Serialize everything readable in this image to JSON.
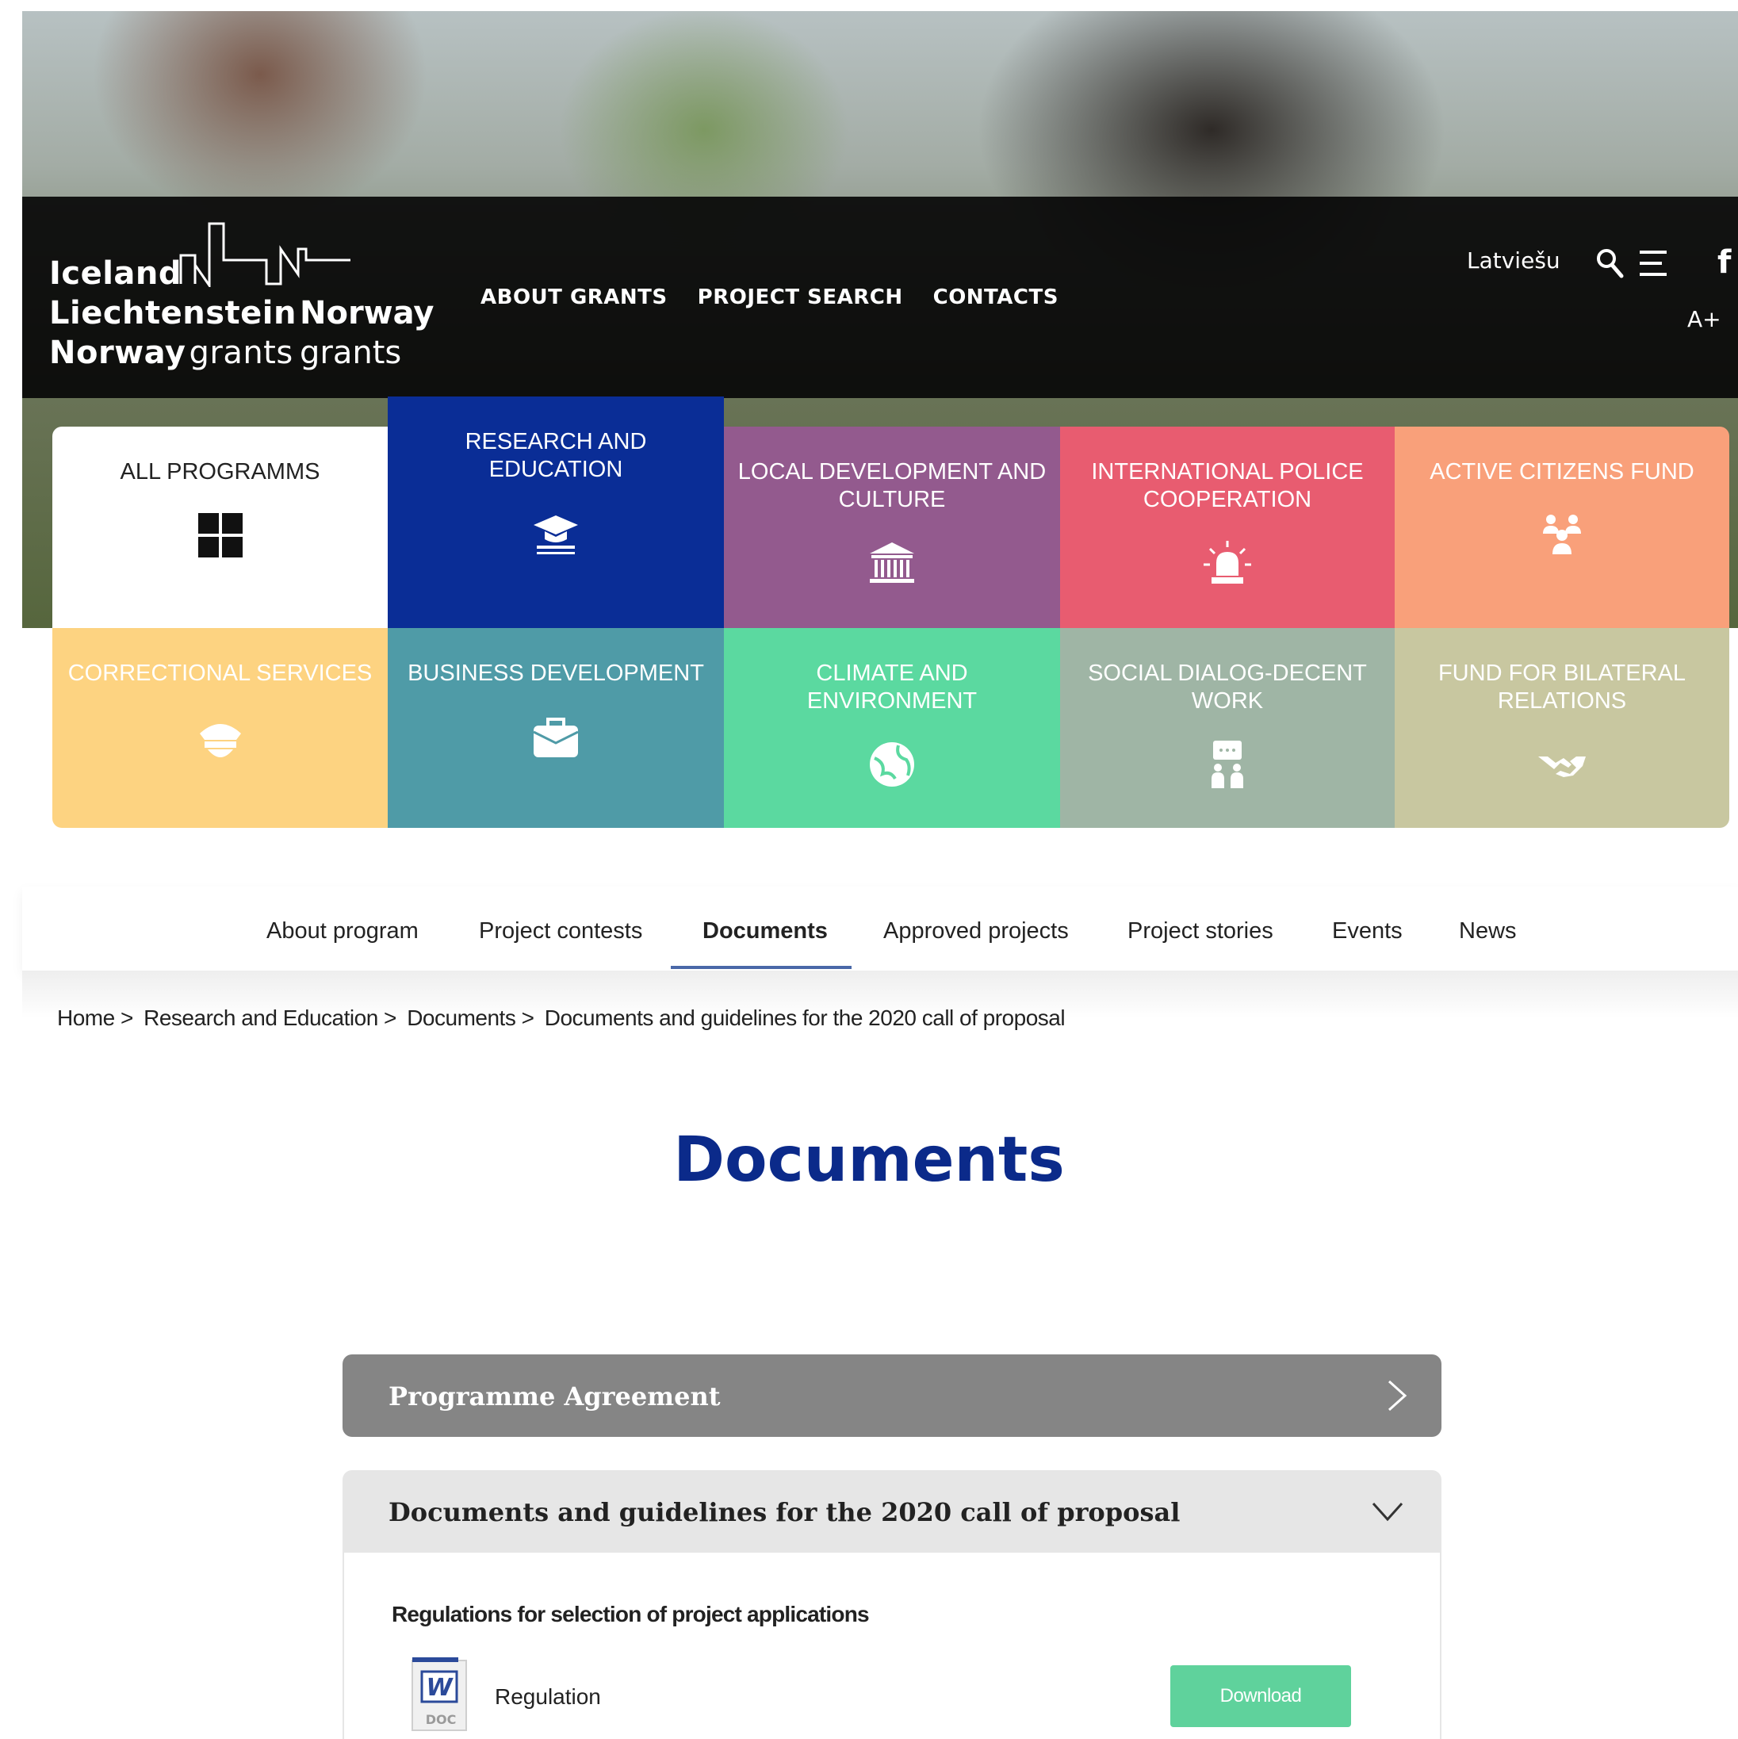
{
  "header": {
    "logo": {
      "line1": "Iceland",
      "line2": "Liechtenstein",
      "line3_bold": "Norway",
      "line3_thin": "grants",
      "right_bold": "Norway",
      "right_thin": "grants"
    },
    "nav": [
      "ABOUT GRANTS",
      "PROJECT SEARCH",
      "CONTACTS"
    ],
    "language": "Latviešu",
    "font_size_toggle": "A+",
    "icons": [
      "search-icon",
      "menu-icon",
      "facebook-icon"
    ]
  },
  "programs": [
    {
      "label": "ALL PROGRAMMS",
      "color": "#ffffff",
      "text_color": "#222222",
      "icon": "grid-icon"
    },
    {
      "label": "RESEARCH AND EDUCATION",
      "color": "#0a2d96",
      "text_color": "#ffffff",
      "icon": "graduation-cap-icon"
    },
    {
      "label": "LOCAL DEVELOPMENT AND CULTURE",
      "color": "#935a8e",
      "text_color": "#ffffff",
      "icon": "museum-icon"
    },
    {
      "label": "INTERNATIONAL POLICE COOPERATION",
      "color": "#e85c70",
      "text_color": "#ffffff",
      "icon": "siren-icon"
    },
    {
      "label": "ACTIVE CITIZENS FUND",
      "color": "#f9a07a",
      "text_color": "#ffffff",
      "icon": "people-icon"
    },
    {
      "label": "CORRECTIONAL SERVICES",
      "color": "#fdd381",
      "text_color": "#ffffff",
      "icon": "police-cap-icon"
    },
    {
      "label": "BUSINESS DEVELOPMENT",
      "color": "#4f9ba7",
      "text_color": "#ffffff",
      "icon": "briefcase-icon"
    },
    {
      "label": "CLIMATE AND ENVIRONMENT",
      "color": "#5bd9a0",
      "text_color": "#ffffff",
      "icon": "globe-icon"
    },
    {
      "label": "SOCIAL DIALOG-DECENT WORK",
      "color": "#9fb5a5",
      "text_color": "#ffffff",
      "icon": "dialog-icon"
    },
    {
      "label": "FUND FOR BILATERAL RELATIONS",
      "color": "#c8c7a0",
      "text_color": "#ffffff",
      "icon": "handshake-icon"
    }
  ],
  "subnav": {
    "items": [
      "About program",
      "Project contests",
      "Documents",
      "Approved projects",
      "Project stories",
      "Events",
      "News"
    ],
    "active": "Documents"
  },
  "breadcrumb": [
    "Home",
    "Research and Education",
    "Documents",
    "Documents and guidelines for the 2020 call of proposal"
  ],
  "page_title": "Documents",
  "accordions": [
    {
      "title": "Programme Agreement",
      "expanded": false
    },
    {
      "title": "Documents and guidelines for the 2020 call of proposal",
      "expanded": true
    }
  ],
  "documents_section": {
    "title": "Regulations for selection of project applications",
    "items": [
      {
        "name": "Regulation",
        "type_label": "DOC",
        "type_icon_letter": "W",
        "action": "Download"
      }
    ]
  }
}
